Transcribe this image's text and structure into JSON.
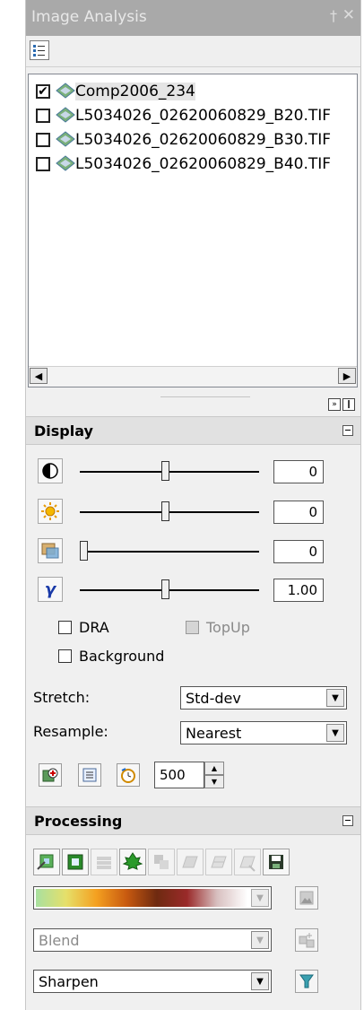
{
  "window": {
    "title": "Image Analysis",
    "pin_glyph": "†",
    "close_glyph": "✕"
  },
  "toolbar": {
    "options_icon": "options-list-icon"
  },
  "layers": [
    {
      "name": "Comp2006_234",
      "checked": true,
      "check_glyph": "✔"
    },
    {
      "name": "L5034026_02620060829_B20.TIF",
      "checked": false,
      "check_glyph": ""
    },
    {
      "name": "L5034026_02620060829_B30.TIF",
      "checked": false,
      "check_glyph": ""
    },
    {
      "name": "L5034026_02620060829_B40.TIF",
      "checked": false,
      "check_glyph": ""
    }
  ],
  "scroll": {
    "left_arrow": "◀",
    "right_arrow": "▶"
  },
  "splitter": {
    "btn1": "»",
    "btn2": "❙"
  },
  "display": {
    "header": "Display",
    "sliders": [
      {
        "icon": "contrast-icon",
        "value": "0",
        "level": 0.5
      },
      {
        "icon": "brightness-icon",
        "value": "0",
        "level": 0.5
      },
      {
        "icon": "transparency-icon",
        "value": "0",
        "level": 0.0
      },
      {
        "icon": "gamma-icon",
        "value": "1.00",
        "level": 0.5,
        "glyph": "γ"
      }
    ],
    "dra_label": "DRA",
    "topup_label": "TopUp",
    "background_label": "Background",
    "stretch_label": "Stretch:",
    "stretch_value": "Std-dev",
    "resample_label": "Resample:",
    "resample_value": "Nearest",
    "refresh_interval": "500",
    "spin_up": "▲",
    "spin_down": "▼"
  },
  "processing": {
    "header": "Processing",
    "blend_placeholder": "Blend",
    "sharpen_value": "Sharpen",
    "dropdown_arrow": "▼"
  },
  "colors": {
    "titlebar": "#a9a9a9",
    "panel": "#f0f0f0",
    "section_header": "#e1e1e1"
  }
}
